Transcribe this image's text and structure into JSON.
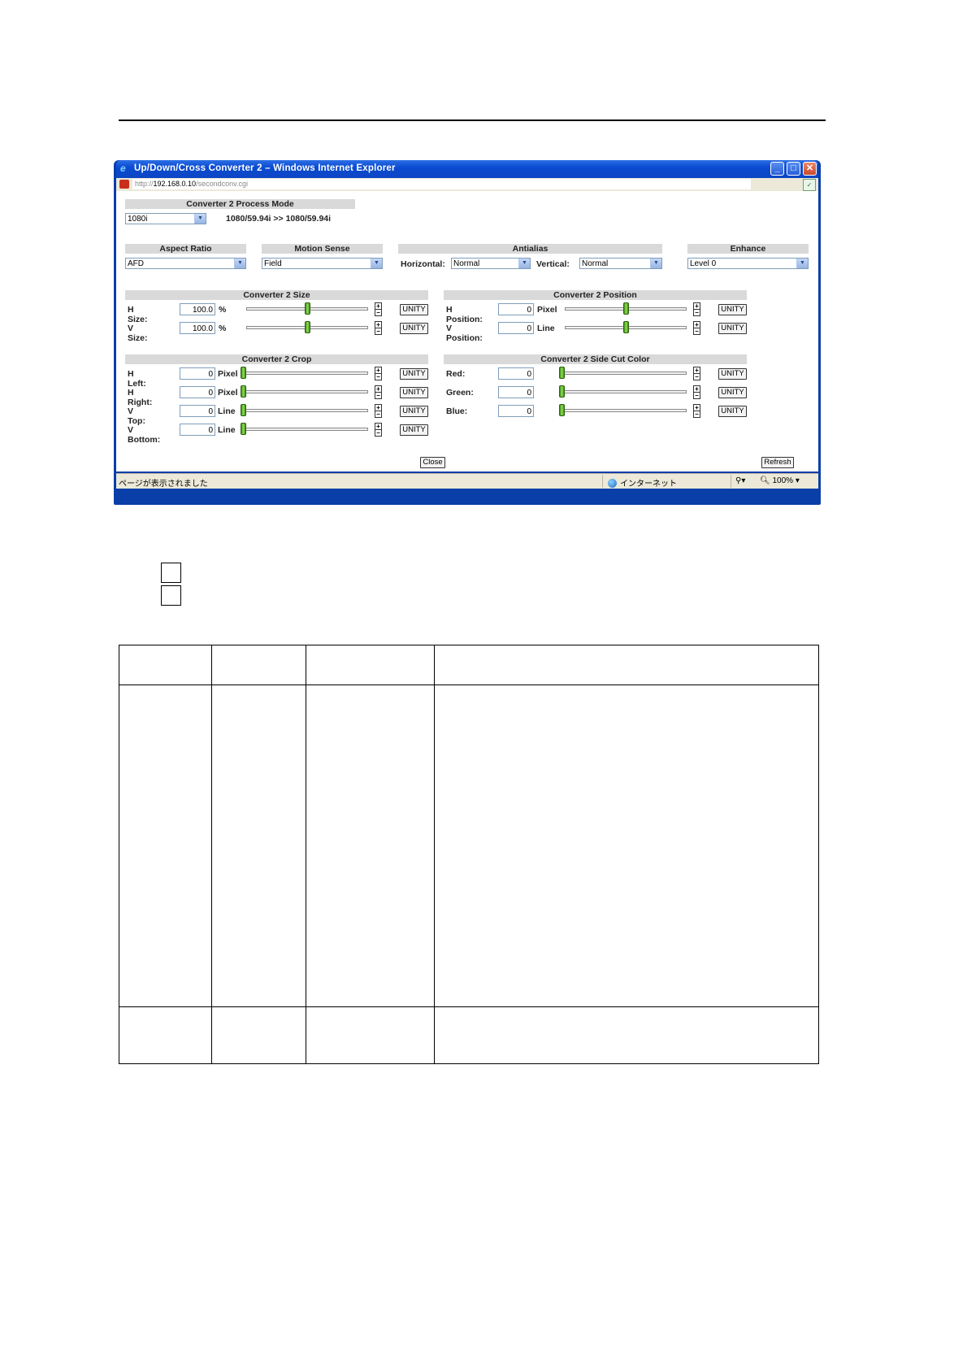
{
  "window": {
    "title": "Up/Down/Cross Converter 2 – Windows Internet Explorer",
    "url_host": "192.168.0.10",
    "url_prefix": "http://",
    "url_path": "/secondconv.cgi",
    "status_text": "ページが表示されました",
    "zone_text": "インターネット",
    "zoom_text": "100%"
  },
  "process_mode": {
    "header": "Converter 2 Process Mode",
    "value": "1080i",
    "format_text": "1080/59.94i >> 1080/59.94i"
  },
  "aspect_ratio": {
    "header": "Aspect Ratio",
    "value": "AFD"
  },
  "motion_sense": {
    "header": "Motion Sense",
    "value": "Field"
  },
  "antialias": {
    "header": "Antialias",
    "horizontal_label": "Horizontal:",
    "horizontal_value": "Normal",
    "vertical_label": "Vertical:",
    "vertical_value": "Normal"
  },
  "enhance": {
    "header": "Enhance",
    "value": "Level 0"
  },
  "size": {
    "header": "Converter 2 Size",
    "rows": [
      {
        "label": "H Size:",
        "value": "100.0",
        "unit": "%",
        "button": "UNITY",
        "slider_fraction": 0.5
      },
      {
        "label": "V Size:",
        "value": "100.0",
        "unit": "%",
        "button": "UNITY",
        "slider_fraction": 0.5
      }
    ]
  },
  "position": {
    "header": "Converter 2 Position",
    "rows": [
      {
        "label": "H Position:",
        "value": "0",
        "unit": "Pixel",
        "button": "UNITY",
        "slider_fraction": 0.5
      },
      {
        "label": "V Position:",
        "value": "0",
        "unit": "Line",
        "button": "UNITY",
        "slider_fraction": 0.5
      }
    ]
  },
  "crop": {
    "header": "Converter 2 Crop",
    "rows": [
      {
        "label": "H Left:",
        "value": "0",
        "unit": "Pixel",
        "button": "UNITY",
        "slider_fraction": 0
      },
      {
        "label": "H Right:",
        "value": "0",
        "unit": "Pixel",
        "button": "UNITY",
        "slider_fraction": 0
      },
      {
        "label": "V Top:",
        "value": "0",
        "unit": "Line",
        "button": "UNITY",
        "slider_fraction": 0
      },
      {
        "label": "V Bottom:",
        "value": "0",
        "unit": "Line",
        "button": "UNITY",
        "slider_fraction": 0
      }
    ]
  },
  "side_cut": {
    "header": "Converter 2 Side Cut Color",
    "rows": [
      {
        "label": "Red:",
        "value": "0",
        "button": "UNITY",
        "slider_fraction": 0
      },
      {
        "label": "Green:",
        "value": "0",
        "button": "UNITY",
        "slider_fraction": 0
      },
      {
        "label": "Blue:",
        "value": "0",
        "button": "UNITY",
        "slider_fraction": 0
      }
    ]
  },
  "buttons": {
    "close": "Close",
    "refresh": "Refresh"
  },
  "colors": {
    "title_bar": "#0a4bd1",
    "section_header": "#d9d9d9",
    "slider_thumb": "#6cc936"
  }
}
